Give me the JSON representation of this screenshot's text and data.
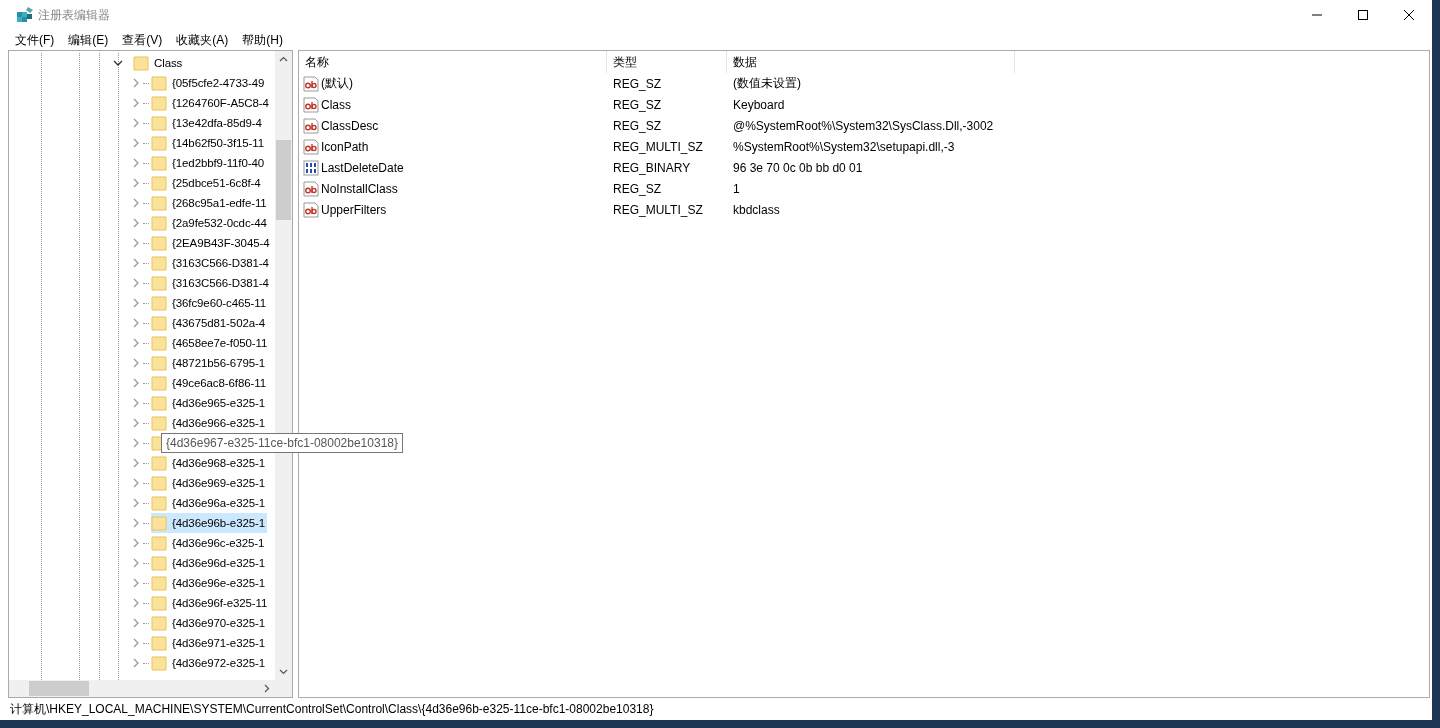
{
  "window": {
    "title": "注册表编辑器"
  },
  "menu": [
    "文件(F)",
    "编辑(E)",
    "查看(V)",
    "收藏夹(A)",
    "帮助(H)"
  ],
  "tree": {
    "label": "Class",
    "expanded": true,
    "children": [
      {
        "label": "{05f5cfe2-4733-49",
        "selected": false
      },
      {
        "label": "{1264760F-A5C8-4",
        "selected": false
      },
      {
        "label": "{13e42dfa-85d9-4",
        "selected": false
      },
      {
        "label": "{14b62f50-3f15-11",
        "selected": false
      },
      {
        "label": "{1ed2bbf9-11f0-40",
        "selected": false
      },
      {
        "label": "{25dbce51-6c8f-4",
        "selected": false
      },
      {
        "label": "{268c95a1-edfe-11",
        "selected": false
      },
      {
        "label": "{2a9fe532-0cdc-44",
        "selected": false
      },
      {
        "label": "{2EA9B43F-3045-4",
        "selected": false
      },
      {
        "label": "{3163C566-D381-4",
        "selected": false
      },
      {
        "label": "{3163C566-D381-4",
        "selected": false
      },
      {
        "label": "{36fc9e60-c465-11",
        "selected": false
      },
      {
        "label": "{43675d81-502a-4",
        "selected": false
      },
      {
        "label": "{4658ee7e-f050-11",
        "selected": false
      },
      {
        "label": "{48721b56-6795-1",
        "selected": false
      },
      {
        "label": "{49ce6ac8-6f86-11",
        "selected": false
      },
      {
        "label": "{4d36e965-e325-1",
        "selected": false
      },
      {
        "label": "{4d36e966-e325-1",
        "selected": false
      },
      {
        "tooltip": "{4d36e967-e325-11ce-bfc1-08002be10318}",
        "selected": false
      },
      {
        "label": "{4d36e968-e325-1",
        "selected": false
      },
      {
        "label": "{4d36e969-e325-1",
        "selected": false
      },
      {
        "label": "{4d36e96a-e325-1",
        "selected": false
      },
      {
        "label": "{4d36e96b-e325-1",
        "selected": true
      },
      {
        "label": "{4d36e96c-e325-1",
        "selected": false
      },
      {
        "label": "{4d36e96d-e325-1",
        "selected": false
      },
      {
        "label": "{4d36e96e-e325-1",
        "selected": false
      },
      {
        "label": "{4d36e96f-e325-11",
        "selected": false
      },
      {
        "label": "{4d36e970-e325-1",
        "selected": false
      },
      {
        "label": "{4d36e971-e325-1",
        "selected": false
      },
      {
        "label": "{4d36e972-e325-1",
        "selected": false
      }
    ]
  },
  "values": {
    "columns": [
      "名称",
      "类型",
      "数据"
    ],
    "rows": [
      {
        "kind": "string",
        "name": "(默认)",
        "type": "REG_SZ",
        "data": "(数值未设置)"
      },
      {
        "kind": "string",
        "name": "Class",
        "type": "REG_SZ",
        "data": "Keyboard"
      },
      {
        "kind": "string",
        "name": "ClassDesc",
        "type": "REG_SZ",
        "data": "@%SystemRoot%\\System32\\SysClass.Dll,-3002"
      },
      {
        "kind": "string",
        "name": "IconPath",
        "type": "REG_MULTI_SZ",
        "data": "%SystemRoot%\\System32\\setupapi.dll,-3"
      },
      {
        "kind": "binary",
        "name": "LastDeleteDate",
        "type": "REG_BINARY",
        "data": "96 3e 70 0c 0b bb d0 01"
      },
      {
        "kind": "string",
        "name": "NoInstallClass",
        "type": "REG_SZ",
        "data": "1"
      },
      {
        "kind": "string",
        "name": "UpperFilters",
        "type": "REG_MULTI_SZ",
        "data": "kbdclass"
      }
    ]
  },
  "status_bar": "计算机\\HKEY_LOCAL_MACHINE\\SYSTEM\\CurrentControlSet\\Control\\Class\\{4d36e96b-e325-11ce-bfc1-08002be10318}"
}
